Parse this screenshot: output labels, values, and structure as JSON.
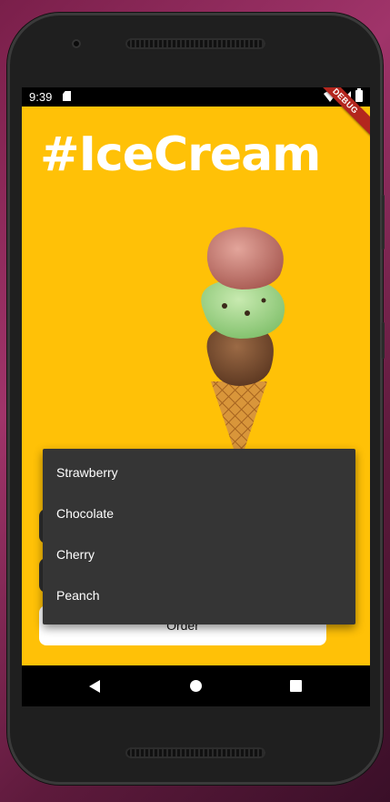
{
  "status_bar": {
    "time": "9:39"
  },
  "debug_banner": "DEBUG",
  "app": {
    "title": "#IceCream",
    "order_button": "Order"
  },
  "dropdown": {
    "items": [
      "Strawberry",
      "Chocolate",
      "Cherry",
      "Peanch"
    ]
  },
  "colors": {
    "background": "#ffc107",
    "menu": "#353535",
    "title_text": "#ffffff"
  },
  "icons": [
    "sd-card-icon",
    "wifi-icon",
    "signal-icon",
    "battery-icon",
    "back-icon",
    "home-icon",
    "recents-icon"
  ]
}
